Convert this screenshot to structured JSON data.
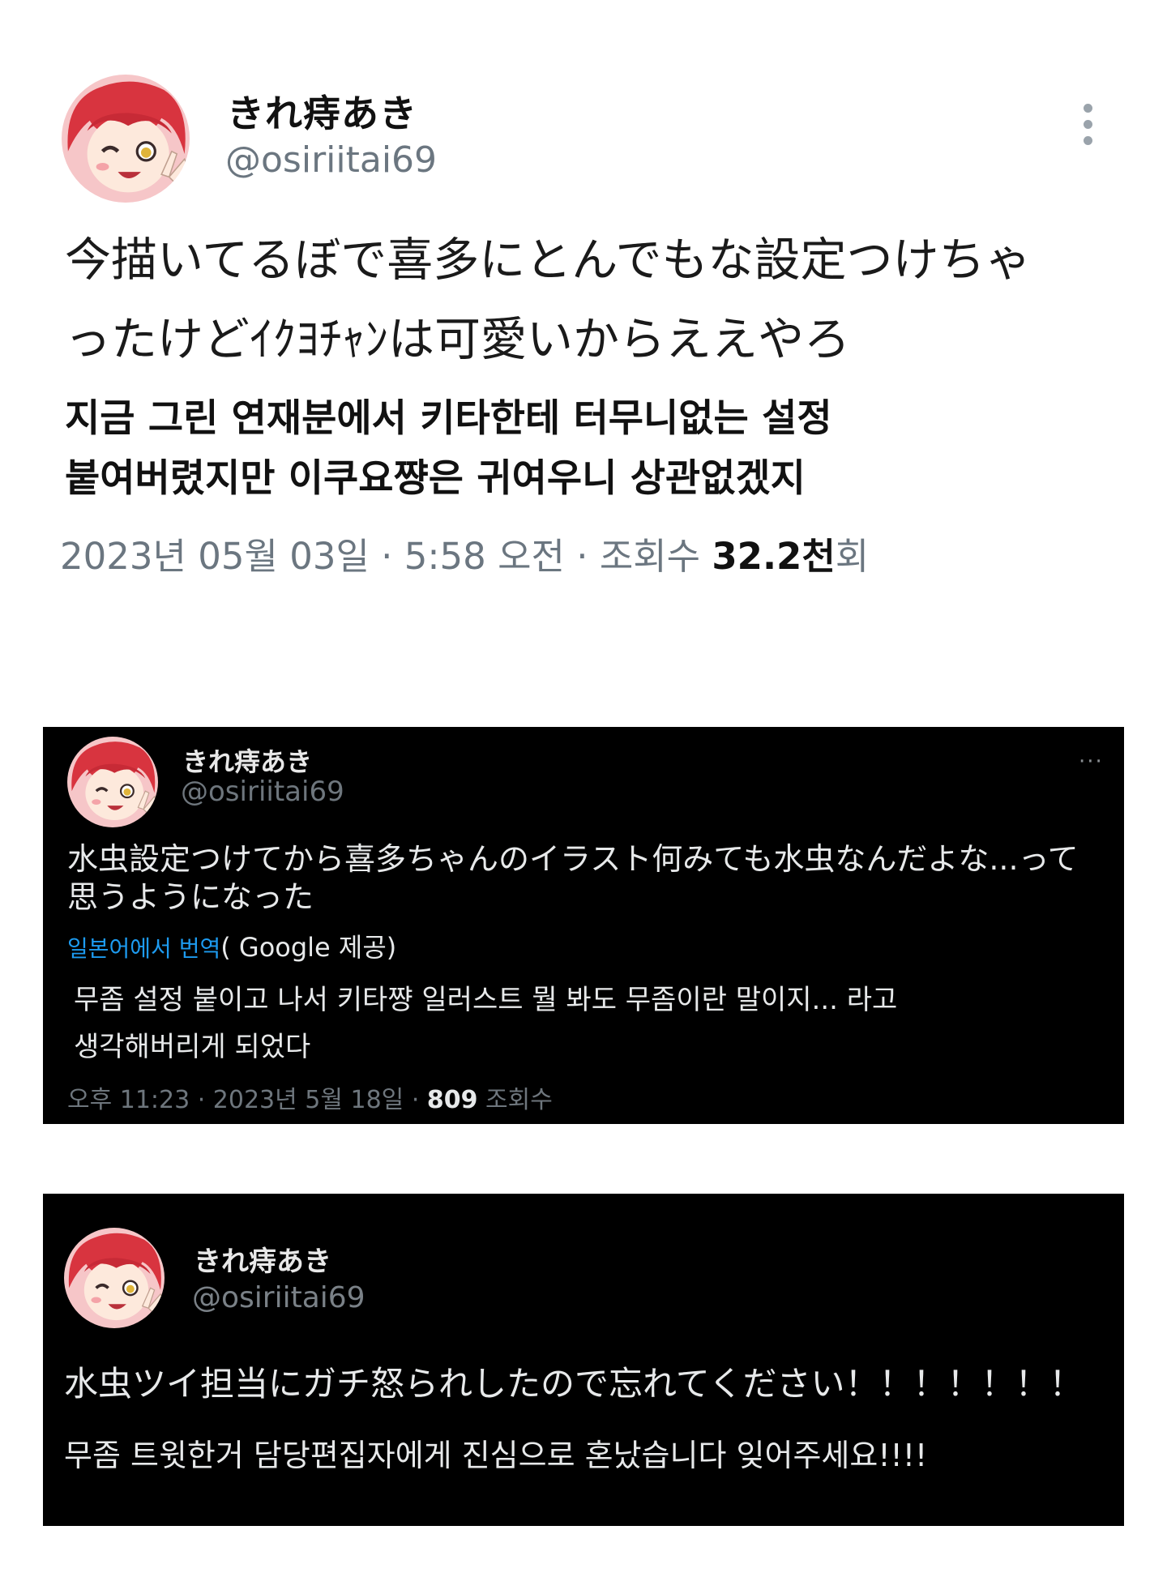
{
  "tweet1": {
    "name": "きれ痔あき",
    "handle": "@osiriitai69",
    "text_line1": "今描いてるぼで喜多にとんでもな設定つけちゃ",
    "text_line2": "ったけどｲｸﾖﾁｬﾝは可愛いからええやろ",
    "translation_line1": "지금 그린 연재분에서 키타한테 터무니없는 설정",
    "translation_line2": "붙여버렸지만 이쿠요쨩은 귀여우니 상관없겠지",
    "meta_prefix": "2023년 05월 03일 · 5:58 오전 · 조회수 ",
    "views": "32.2천",
    "views_suffix": "회"
  },
  "tweet2": {
    "name": "きれ痔あき",
    "handle": "@osiriitai69",
    "more": "···",
    "text_line1": "水虫設定つけてから喜多ちゃんのイラスト何みても水虫なんだよな...って",
    "text_line2": "思うようになった",
    "translate_link": "일본어에서 번역",
    "translate_provider": "( Google 제공)",
    "translation_line1": "무좀 설정 붙이고 나서 키타쨩 일러스트 뭘 봐도 무좀이란 말이지... 라고",
    "translation_line2": "생각해버리게 되었다",
    "meta_prefix": "오후 11:23 · 2023년 5월 18일 · ",
    "views": "809",
    "views_suffix": " 조회수"
  },
  "tweet3": {
    "name": "きれ痔あき",
    "handle": "@osiriitai69",
    "text": "水虫ツイ担当にガチ怒られしたので忘れてください！！！！！！！",
    "translation": "무좀 트윗한거 담당편집자에게 진심으로 혼났습니다 잊어주세요!!!!"
  },
  "colors": {
    "dark_bg": "#000000",
    "link_blue": "#1d9bf0",
    "muted_gray": "#6b7680"
  },
  "icons": {
    "avatar": "anime-girl-avatar",
    "more": "more-vertical-icon"
  }
}
